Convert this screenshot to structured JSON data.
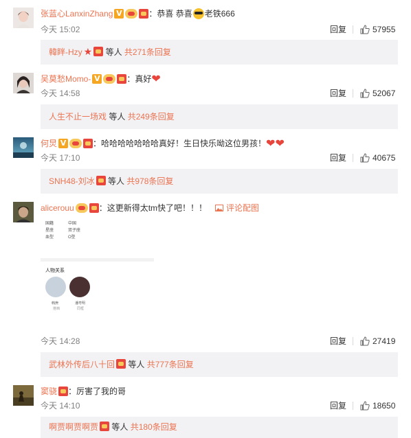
{
  "comments": [
    {
      "username": "张蓝心LanxinZhang",
      "text_pre": "：恭喜 恭喜",
      "text_post": "老铁666",
      "time": "今天 15:02",
      "reply_label": "回复",
      "likes": "57955",
      "subreply": {
        "user": "韓眫-Hzy",
        "mid": " 等人 ",
        "count": "共271条回复"
      }
    },
    {
      "username": "吴莫愁Momo-",
      "text": "：真好",
      "time": "今天 14:58",
      "reply_label": "回复",
      "likes": "52067",
      "subreply": {
        "user": "人生不止一场戏",
        "mid": " 等人 ",
        "count": "共249条回复"
      }
    },
    {
      "username": "何炅",
      "text": "：哈哈哈哈哈哈哈真好！生日快乐呦这位男孩！",
      "time": "今天 17:10",
      "reply_label": "回复",
      "likes": "40675",
      "subreply": {
        "user": "SNH48-刘冰",
        "mid": " 等人 ",
        "count": "共978条回复"
      }
    },
    {
      "username": "alicerouu",
      "text": "：这更新得太tm快了吧！！！",
      "view_image": "评论配图",
      "time": "今天 14:28",
      "reply_label": "回复",
      "likes": "27419",
      "subreply": {
        "user": "武林外传后八十回",
        "mid": " 等人 ",
        "count": "共777条回复"
      },
      "screenshot": {
        "rows": [
          {
            "k": "国籍",
            "v": "中国"
          },
          {
            "k": "星座",
            "v": "双子座"
          },
          {
            "k": "血型",
            "v": "O型"
          }
        ],
        "section_title": "人物关系",
        "people": [
          {
            "name": "韩庚",
            "relation": "搭档"
          },
          {
            "name": "潘粤明",
            "relation": "同框"
          }
        ]
      }
    },
    {
      "username": "窦骁",
      "text": "：厉害了我的哥",
      "time": "今天 14:10",
      "reply_label": "回复",
      "likes": "18650",
      "subreply": {
        "user": "啊贾啊贾啊贾",
        "mid": " 等人 ",
        "count": "共180条回复"
      }
    }
  ],
  "colors": {
    "link": "#eb7350",
    "meta": "#808080",
    "subreply_bg": "#f2f2f5"
  },
  "icons": [
    "v-badge-icon",
    "vip-badge-icon",
    "medal-icon",
    "star-icon",
    "heart-emoji-icon",
    "cool-emoji-icon",
    "thumb-up-icon",
    "image-icon"
  ]
}
